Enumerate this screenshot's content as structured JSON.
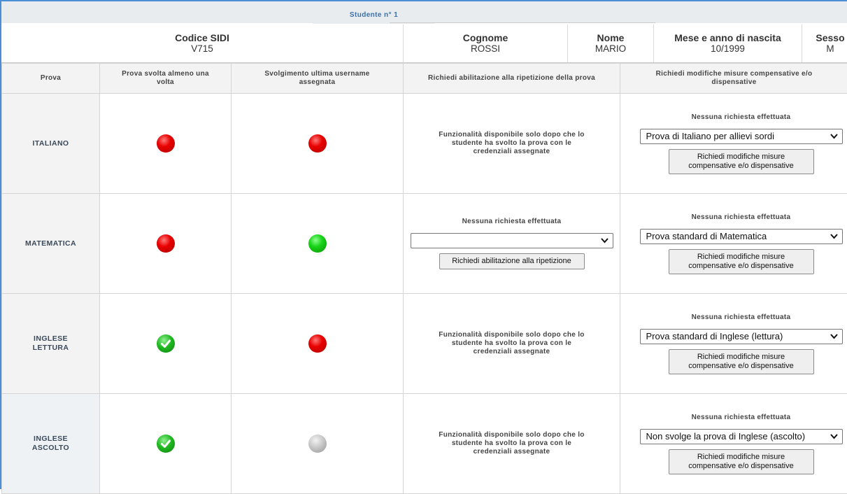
{
  "student_tab": "Studente n° 1",
  "info": {
    "codice": {
      "label": "Codice SIDI",
      "value": "V715"
    },
    "cognome": {
      "label": "Cognome",
      "value": "ROSSI"
    },
    "nome": {
      "label": "Nome",
      "value": "MARIO"
    },
    "nascita": {
      "label": "Mese e anno di nascita",
      "value": "10/1999"
    },
    "sesso": {
      "label": "Sesso",
      "value": "M"
    }
  },
  "headers": {
    "prova": "Prova",
    "svolta": "Prova svolta almeno una volta",
    "ultima": "Svolgimento ultima username assegnata",
    "abilitazione": "Richiedi abilitazione alla ripetizione della prova",
    "modifiche": "Richiedi modifiche misure compensative e/o dispensative"
  },
  "rows": [
    {
      "prova_line1": "ITALIANO",
      "prova_line2": "",
      "svolta": "red",
      "ultima": "red",
      "abilitazione_msg": "Funzionalità disponibile solo dopo che lo studente ha svolto la prova con le credenziali assegnate",
      "modifiche_status": "Nessuna richiesta effettuata",
      "modifiche_select": "Prova di Italiano per allievi sordi",
      "modifiche_button": "Richiedi modifiche misure compensative e/o dispensative"
    },
    {
      "prova_line1": "MATEMATICA",
      "prova_line2": "",
      "svolta": "red",
      "ultima": "green",
      "abilitazione_status": "Nessuna richiesta effettuata",
      "abilitazione_select": "",
      "abilitazione_button": "Richiedi abilitazione alla ripetizione",
      "modifiche_status": "Nessuna richiesta effettuata",
      "modifiche_select": "Prova standard di Matematica",
      "modifiche_button": "Richiedi modifiche misure compensative e/o dispensative"
    },
    {
      "prova_line1": "INGLESE",
      "prova_line2": "LETTURA",
      "svolta": "check",
      "ultima": "red",
      "abilitazione_msg": "Funzionalità disponibile solo dopo che lo studente ha svolto la prova con le credenziali assegnate",
      "modifiche_status": "Nessuna richiesta effettuata",
      "modifiche_select": "Prova standard di Inglese (lettura)",
      "modifiche_button": "Richiedi modifiche misure compensative e/o dispensative"
    },
    {
      "prova_line1": "INGLESE",
      "prova_line2": "ASCOLTO",
      "svolta": "check",
      "ultima": "grey",
      "abilitazione_msg": "Funzionalità disponibile solo dopo che lo studente ha svolto la prova con le credenziali assegnate",
      "modifiche_status": "Nessuna richiesta effettuata",
      "modifiche_select": "Non svolge la prova di Inglese (ascolto)",
      "modifiche_button": "Richiedi modifiche misure compensative e/o dispensative"
    }
  ],
  "colors": {
    "accent_border": "#4a8fd6",
    "red": "#e80000",
    "green": "#18d418",
    "grey": "#c8c8c8"
  }
}
